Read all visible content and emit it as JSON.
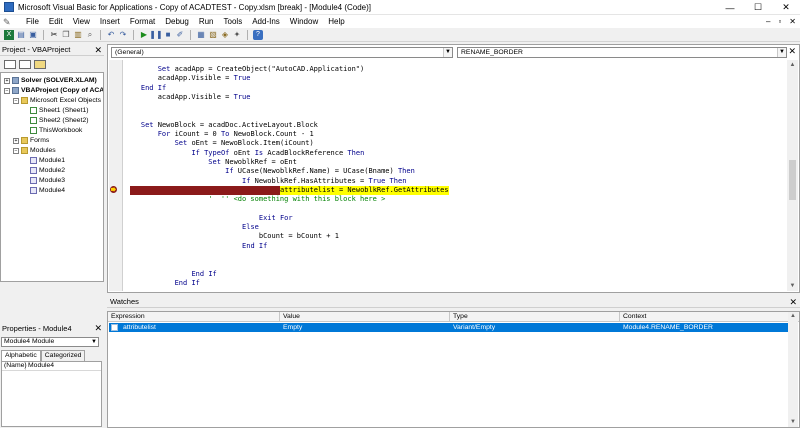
{
  "window": {
    "title": "Microsoft Visual Basic for Applications - Copy of ACADTEST - Copy.xlsm [break] - [Module4 (Code)]",
    "minimize": "—",
    "maximize": "☐",
    "close": "✕"
  },
  "menu": {
    "items": [
      "File",
      "Edit",
      "View",
      "Insert",
      "Format",
      "Debug",
      "Run",
      "Tools",
      "Add-Ins",
      "Window",
      "Help"
    ],
    "controls": {
      "minimize": "–",
      "restore": "▫",
      "close": "✕"
    }
  },
  "toolbar": {
    "icons": [
      "excel-icon",
      "insert-module-icon",
      "save-icon",
      "cut-icon",
      "copy-icon",
      "paste-icon",
      "find-icon",
      "undo-icon",
      "redo-icon",
      "run-icon",
      "break-icon",
      "reset-icon",
      "design-mode-icon",
      "project-explorer-icon",
      "properties-icon",
      "object-browser-icon",
      "toolbox-icon",
      "help-icon"
    ]
  },
  "project_pane": {
    "title": "Project - VBAProject",
    "close": "✕",
    "tree": [
      {
        "label": "Solver (SOLVER.XLAM)",
        "level": 0,
        "type": "project",
        "expand": "+"
      },
      {
        "label": "VBAProject (Copy of ACA",
        "level": 0,
        "type": "project",
        "expand": "−"
      },
      {
        "label": "Microsoft Excel Objects",
        "level": 1,
        "type": "folder",
        "expand": "−"
      },
      {
        "label": "Sheet1 (Sheet1)",
        "level": 2,
        "type": "sheet",
        "expand": ""
      },
      {
        "label": "Sheet2 (Sheet2)",
        "level": 2,
        "type": "sheet",
        "expand": ""
      },
      {
        "label": "ThisWorkbook",
        "level": 2,
        "type": "sheet",
        "expand": ""
      },
      {
        "label": "Forms",
        "level": 1,
        "type": "folder",
        "expand": "+"
      },
      {
        "label": "Modules",
        "level": 1,
        "type": "folder",
        "expand": "−"
      },
      {
        "label": "Module1",
        "level": 2,
        "type": "module",
        "expand": ""
      },
      {
        "label": "Module2",
        "level": 2,
        "type": "module",
        "expand": ""
      },
      {
        "label": "Module3",
        "level": 2,
        "type": "module",
        "expand": ""
      },
      {
        "label": "Module4",
        "level": 2,
        "type": "module",
        "expand": ""
      }
    ]
  },
  "properties_pane": {
    "title": "Properties - Module4",
    "close": "✕",
    "object": "Module4  Module",
    "tabs": [
      "Alphabetic",
      "Categorized"
    ],
    "rows": [
      {
        "name": "(Name)",
        "value": "Module4"
      }
    ]
  },
  "code_window": {
    "object_combo": "(General)",
    "proc_combo": "RENAME_BORDER",
    "lines": [
      {
        "text": "        Set acadApp = CreateObject(\"AutoCAD.Application\")",
        "style": "normal"
      },
      {
        "text": "        acadApp.Visible = True",
        "style": "normal"
      },
      {
        "text": "    End If",
        "style": "kw"
      },
      {
        "text": "        acadApp.Visible = True",
        "style": "normal"
      },
      {
        "text": "",
        "style": "normal"
      },
      {
        "text": "",
        "style": "normal"
      },
      {
        "text": "    Set NewoBlock = acadDoc.ActiveLayout.Block",
        "style": "normal"
      },
      {
        "text": "        For iCount = 0 To NewoBlock.Count - 1",
        "style": "normal"
      },
      {
        "text": "            Set oEnt = NewoBlock.Item(iCount)",
        "style": "normal"
      },
      {
        "text": "                If TypeOf oEnt Is AcadBlockReference Then",
        "style": "normal"
      },
      {
        "text": "                    Set NewoblkRef = oEnt",
        "style": "normal"
      },
      {
        "text": "                        If UCase(NewoblkRef.Name) = UCase(Bname) Then",
        "style": "normal"
      },
      {
        "text": "                            If NewoblkRef.HasAttributes = True Then",
        "style": "normal"
      },
      {
        "text": "attributelist = NewoblkRef.GetAttributes",
        "style": "exec"
      },
      {
        "text": "                    '  '' <do something with this block here >",
        "style": "comment"
      },
      {
        "text": "",
        "style": "normal"
      },
      {
        "text": "                                Exit For",
        "style": "normal"
      },
      {
        "text": "                            Else",
        "style": "normal"
      },
      {
        "text": "                                bCount = bCount + 1",
        "style": "normal"
      },
      {
        "text": "                            End If",
        "style": "normal"
      },
      {
        "text": "",
        "style": "normal"
      },
      {
        "text": "",
        "style": "normal"
      },
      {
        "text": "                End If",
        "style": "normal"
      },
      {
        "text": "            End If",
        "style": "normal"
      }
    ]
  },
  "watches": {
    "title": "Watches",
    "close": "✕",
    "columns": [
      "Expression",
      "Value",
      "Type",
      "Context"
    ],
    "rows": [
      {
        "expression": "attributelist",
        "value": "Empty",
        "type": "Variant/Empty",
        "context": "Module4.RENAME_BORDER"
      }
    ]
  },
  "colors": {
    "breakpoint": "#8b1a1a",
    "exec_highlight": "#ffff00",
    "selection": "#0078d7",
    "keyword": "#00008b",
    "comment": "#008000"
  }
}
